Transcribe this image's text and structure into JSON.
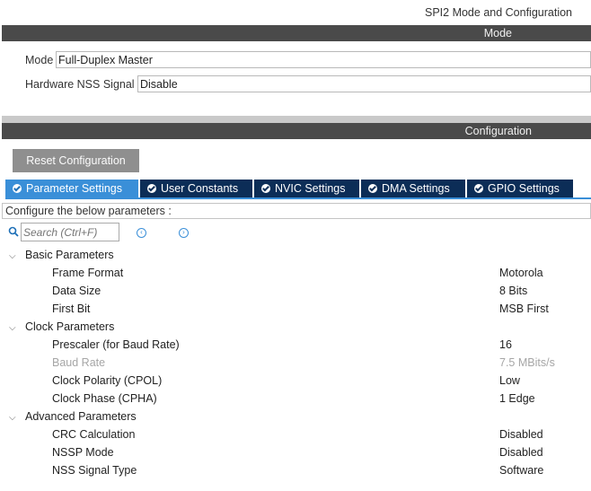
{
  "header": {
    "title": "SPI2 Mode and Configuration"
  },
  "mode_section": {
    "band_label": "Mode",
    "mode_label": "Mode",
    "mode_value": "Full-Duplex Master",
    "nss_label": "Hardware NSS Signal",
    "nss_value": "Disable"
  },
  "config_section": {
    "band_label": "Configuration",
    "reset_label": "Reset Configuration",
    "tabs": [
      {
        "label": "Parameter Settings",
        "active": true
      },
      {
        "label": "User Constants"
      },
      {
        "label": "NVIC Settings"
      },
      {
        "label": "DMA Settings"
      },
      {
        "label": "GPIO Settings"
      }
    ],
    "hint": "Configure the below parameters :",
    "search_placeholder": "Search (Ctrl+F)"
  },
  "groups": [
    {
      "name": "Basic Parameters",
      "params": [
        {
          "name": "Frame Format",
          "value": "Motorola"
        },
        {
          "name": "Data Size",
          "value": "8 Bits"
        },
        {
          "name": "First Bit",
          "value": "MSB First"
        }
      ]
    },
    {
      "name": "Clock Parameters",
      "params": [
        {
          "name": "Prescaler (for Baud Rate)",
          "value": "16"
        },
        {
          "name": "Baud Rate",
          "value": "7.5 MBits/s",
          "disabled": true
        },
        {
          "name": "Clock Polarity (CPOL)",
          "value": "Low"
        },
        {
          "name": "Clock Phase (CPHA)",
          "value": "1 Edge"
        }
      ]
    },
    {
      "name": "Advanced Parameters",
      "params": [
        {
          "name": "CRC Calculation",
          "value": "Disabled"
        },
        {
          "name": "NSSP Mode",
          "value": "Disabled"
        },
        {
          "name": "NSS Signal Type",
          "value": "Software"
        }
      ]
    }
  ],
  "colors": {
    "band": "#4a4a4a",
    "tab_active": "#3a8fd8",
    "tab_inactive": "#0c2d57",
    "button": "#8f8f8f"
  }
}
